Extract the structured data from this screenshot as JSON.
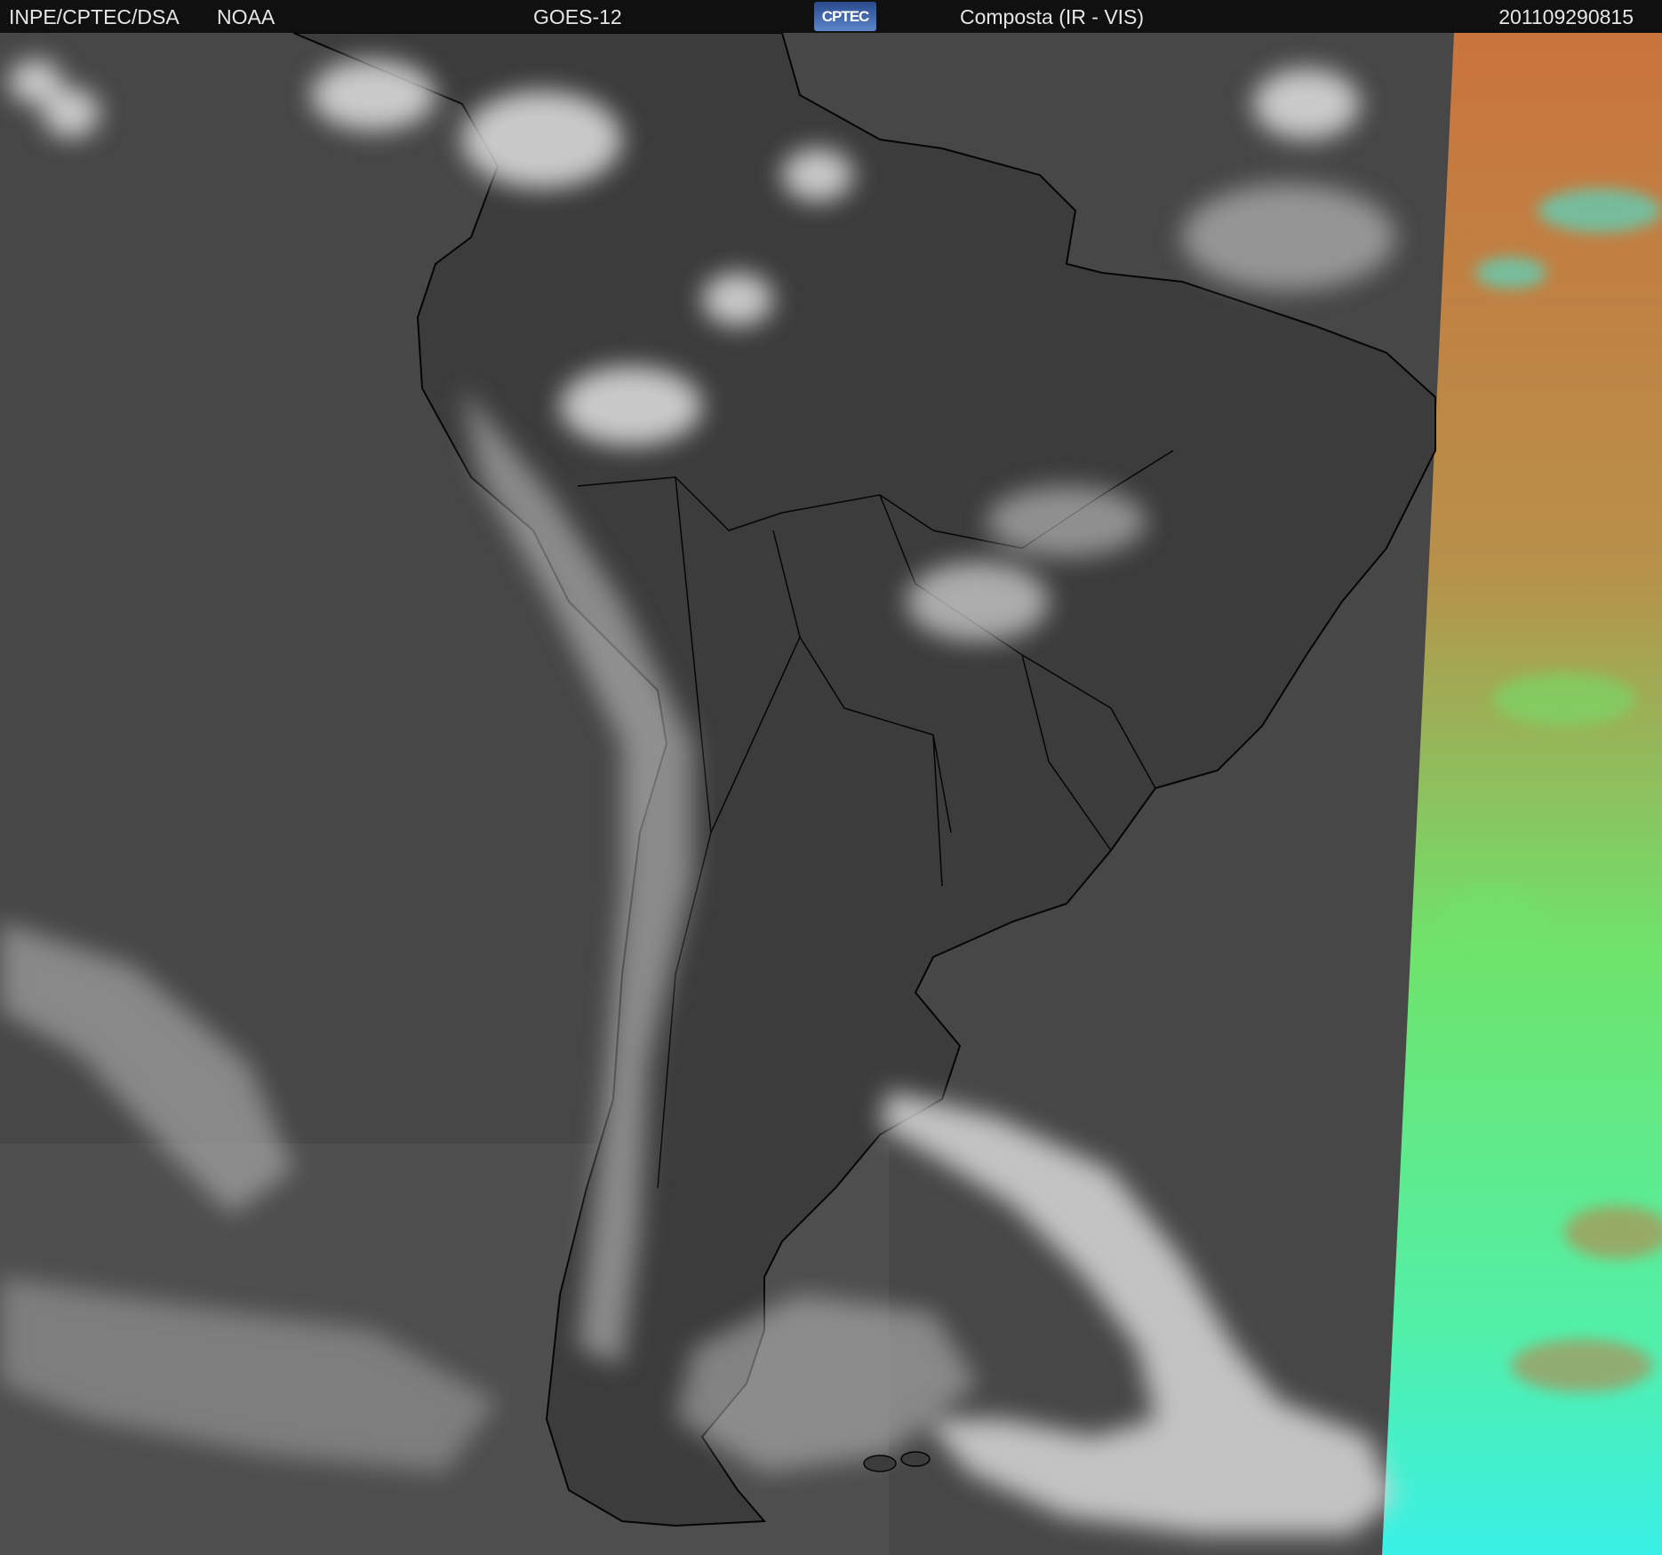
{
  "header": {
    "agency": "INPE/CPTEC/DSA",
    "source": "NOAA",
    "satellite": "GOES-12",
    "logo_text": "CPTEC",
    "product": "Composta (IR - VIS)",
    "timestamp": "201109290815"
  },
  "colors": {
    "header_bg": "#101010",
    "header_text": "#e6e6e6",
    "ocean_ir": "#474747",
    "land_ir": "#3c3c3c",
    "cloud": "#d9d9d9",
    "coastline": "#050505",
    "vis_orange": "#c9743d",
    "vis_green": "#6fe36a",
    "vis_cyan": "#39f0e6"
  }
}
